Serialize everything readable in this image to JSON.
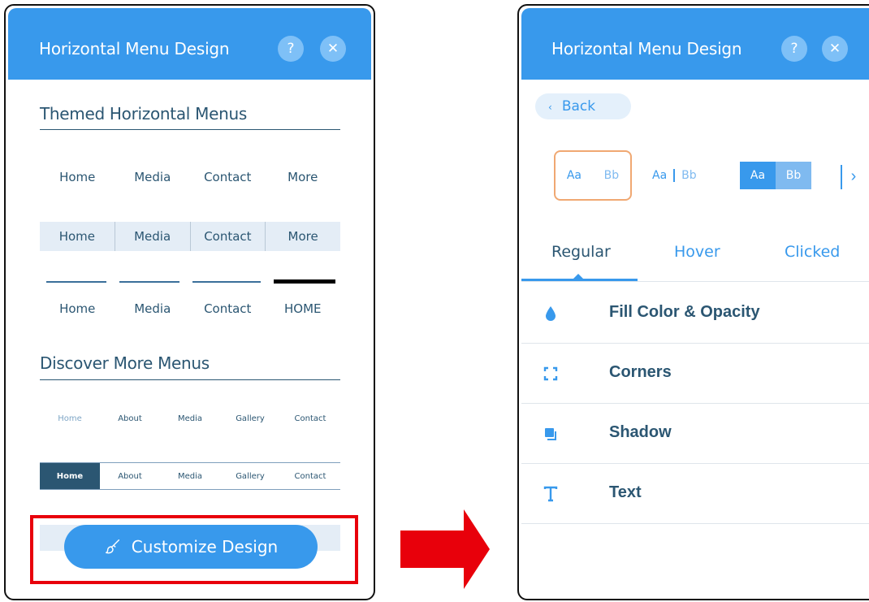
{
  "left_panel": {
    "title": "Horizontal Menu Design",
    "help_label": "?",
    "close_label": "✕",
    "themed_section_title": "Themed Horizontal Menus",
    "themed_rows": [
      [
        "Home",
        "Media",
        "Contact",
        "More"
      ],
      [
        "Home",
        "Media",
        "Contact",
        "More"
      ],
      [
        "Home",
        "Media",
        "Contact",
        "HOME"
      ]
    ],
    "discover_section_title": "Discover More Menus",
    "discover_rows": [
      [
        "Home",
        "About",
        "Media",
        "Gallery",
        "Contact"
      ],
      [
        "Home",
        "About",
        "Media",
        "Gallery",
        "Contact"
      ]
    ],
    "customize_button": "Customize Design"
  },
  "right_panel": {
    "title": "Horizontal Menu Design",
    "help_label": "?",
    "close_label": "✕",
    "back_label": "Back",
    "presets": [
      {
        "a": "Aa",
        "b": "Bb"
      },
      {
        "a": "Aa",
        "b": "Bb"
      },
      {
        "a": "Aa",
        "b": "Bb"
      }
    ],
    "preset_next": "›",
    "tabs": [
      "Regular",
      "Hover",
      "Clicked"
    ],
    "active_tab": "Regular",
    "options": [
      {
        "label": "Fill Color & Opacity",
        "icon": "droplet-icon"
      },
      {
        "label": "Corners",
        "icon": "corners-icon"
      },
      {
        "label": "Shadow",
        "icon": "shadow-icon"
      },
      {
        "label": "Text",
        "icon": "text-icon"
      }
    ]
  },
  "colors": {
    "header_blue": "#3899ec",
    "text_navy": "#2b5672",
    "highlight_red": "#e8000b",
    "selected_preset_border": "#f0a872"
  }
}
